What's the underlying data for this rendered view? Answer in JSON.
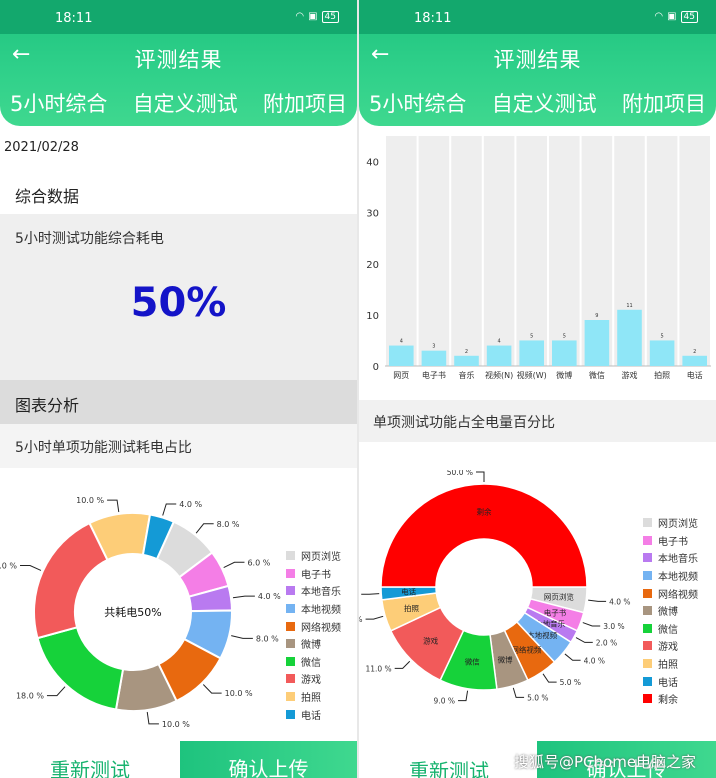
{
  "status": {
    "time": "18:11",
    "battery": "45"
  },
  "header": {
    "title": "评测结果",
    "back_icon": "arrow-left-icon",
    "tabs": [
      "5小时综合",
      "自定义测试",
      "附加项目"
    ]
  },
  "left": {
    "date": "2021/02/28",
    "section1": "综合数据",
    "overall_label": "5小时测试功能综合耗电",
    "overall_value": "50%",
    "section2": "图表分析",
    "subtitle": "5小时单项功能测试耗电占比",
    "buttons": {
      "retest": "重新测试",
      "upload": "确认上传"
    }
  },
  "right": {
    "subtitle": "单项测试功能占全电量百分比",
    "buttons": {
      "retest": "重新测试",
      "upload": "确认上传"
    }
  },
  "watermark": "搜狐号@PChome电脑之家",
  "chart_data": [
    {
      "type": "pie",
      "variant": "donut",
      "center_text": "共耗电50%",
      "categories": [
        "网页浏览",
        "电子书",
        "本地音乐",
        "本地视频",
        "网络视频",
        "微博",
        "微信",
        "游戏",
        "拍照",
        "电话"
      ],
      "values": [
        8.0,
        6.0,
        4.0,
        8.0,
        10.0,
        10.0,
        18.0,
        22.0,
        10.0,
        4.0
      ],
      "value_labels": [
        "8.0 %",
        "6.0 %",
        "4.0 %",
        "8.0 %",
        "10.0 %",
        "10.0 %",
        "18.0 %",
        "22.0 %",
        "10.0 %",
        "4.0 %"
      ],
      "colors": [
        "#dcdcdc",
        "#f47ee6",
        "#b97af0",
        "#74b3f2",
        "#e8690f",
        "#a89580",
        "#16d23a",
        "#f25a5a",
        "#fdcd78",
        "#149ad6"
      ],
      "legend": "right"
    },
    {
      "type": "bar",
      "categories": [
        "网页",
        "电子书",
        "音乐",
        "视频(N)",
        "视频(W)",
        "微博",
        "微信",
        "游戏",
        "拍照",
        "电话"
      ],
      "values": [
        4,
        3,
        2,
        4,
        5,
        5,
        9,
        11,
        5,
        2
      ],
      "value_labels": [
        "4",
        "3",
        "2",
        "4",
        "5",
        "5",
        "9",
        "11",
        "5",
        "2"
      ],
      "ylim": [
        0,
        45
      ],
      "yticks": [
        "0",
        "10",
        "20",
        "30",
        "40"
      ],
      "color": "#8fe6f7",
      "grid": true
    },
    {
      "type": "pie",
      "variant": "half-donut",
      "categories": [
        "网页浏览",
        "电子书",
        "本地音乐",
        "本地视频",
        "网络视频",
        "微博",
        "微信",
        "游戏",
        "拍照",
        "电话",
        "剩余"
      ],
      "values": [
        4.0,
        3.0,
        2.0,
        4.0,
        5.0,
        5.0,
        9.0,
        11.0,
        5.0,
        2.0,
        50.0
      ],
      "value_labels": [
        "4.0 %",
        "3.0 %",
        "2.0 %",
        "4.0 %",
        "5.0 %",
        "5.0 %",
        "9.0 %",
        "11.0 %",
        "5.0 %",
        "2.0 %",
        "50.0 %"
      ],
      "slice_labels": [
        "网页浏览",
        "电子书",
        "本地音乐",
        "本地视频",
        "网络视频",
        "微博",
        "微信",
        "游戏",
        "拍照",
        "电话",
        "剩余"
      ],
      "colors": [
        "#dcdcdc",
        "#f47ee6",
        "#b97af0",
        "#74b3f2",
        "#e8690f",
        "#a89580",
        "#16d23a",
        "#f25a5a",
        "#fdcd78",
        "#149ad6",
        "#ff0000"
      ],
      "legend": "right"
    }
  ]
}
